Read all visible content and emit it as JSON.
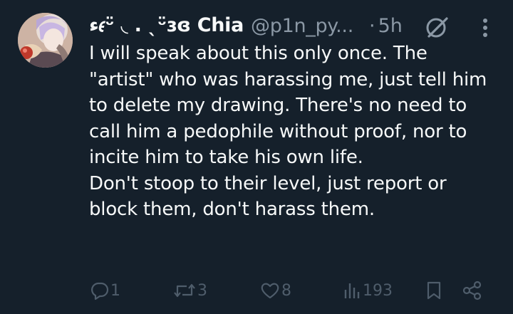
{
  "tweet": {
    "author": {
      "display_name": "ء𝜖ᵕ̈ ◟ . ˎᵕ̈ɜɞ Chia",
      "handle": "@p1n_py...",
      "time": "5h"
    },
    "text_paragraphs": [
      "I will speak about this only once. The \"artist\" who was harassing me, just tell him to delete my drawing. There's no need to call him a pedophile without proof, nor to incite him to take his own life.",
      "Don't stoop to their level, just report or block them, don't harass them."
    ],
    "stats": {
      "replies": "1",
      "reposts": "3",
      "likes": "8",
      "views": "193"
    }
  },
  "icons": {
    "reply": "reply-icon",
    "repost": "repost-icon",
    "like": "heart-icon",
    "views": "views-icon",
    "bookmark": "bookmark-icon",
    "share": "share-icon",
    "grok": "grok-icon",
    "more": "more-options-icon"
  },
  "colors": {
    "background": "#15202b",
    "primary_text": "#f7f9f9",
    "secondary_text": "#8b98a5",
    "action_icons": "#4f5d6b"
  }
}
